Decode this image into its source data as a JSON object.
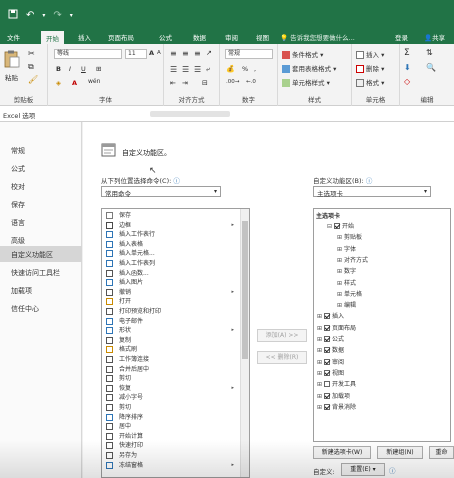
{
  "qat": {
    "save_icon": "save-icon",
    "undo_icon": "undo-icon",
    "redo_icon": "redo-icon"
  },
  "ribbon_tabs": [
    "文件",
    "开始",
    "插入",
    "页面布局",
    "公式",
    "数据",
    "审阅",
    "视图"
  ],
  "active_tab": "开始",
  "tell_me": "告诉我您想要做什么...",
  "login": "登录",
  "share": "共享",
  "ribbon": {
    "clipboard": {
      "paste": "粘贴",
      "label": "剪贴板"
    },
    "font": {
      "name": "等线",
      "size": "11",
      "bold": "B",
      "italic": "I",
      "underline": "U",
      "grow": "A",
      "shrink": "A",
      "wen": "wén",
      "label": "字体"
    },
    "alignment": {
      "label": "对齐方式"
    },
    "number": {
      "format": "常规",
      "percent": "%",
      "comma": ",",
      "label": "数字"
    },
    "styles": {
      "conditional": "条件格式",
      "table": "套用表格格式",
      "cell": "单元格样式",
      "label": "样式"
    },
    "cells": {
      "insert": "插入",
      "delete": "删除",
      "format": "格式",
      "label": "单元格"
    },
    "editing": {
      "sigma": "Σ",
      "label": "编辑"
    }
  },
  "dialog": {
    "title": "Excel 选项",
    "nav": [
      "常规",
      "公式",
      "校对",
      "保存",
      "语言",
      "高级",
      "自定义功能区",
      "快速访问工具栏",
      "加载项",
      "信任中心"
    ],
    "selected_nav": "自定义功能区",
    "heading": "自定义功能区。",
    "choose_from_label": "从下列位置选择命令(C):",
    "choose_from_value": "常用命令",
    "customize_label": "自定义功能区(B):",
    "customize_value": "主选项卡",
    "commands": [
      {
        "icon": "save-icon",
        "label": "保存",
        "sub": ""
      },
      {
        "icon": "border-icon",
        "label": "边框",
        "sub": "▸"
      },
      {
        "icon": "insert-row-icon",
        "label": "插入工作表行",
        "sub": ""
      },
      {
        "icon": "table-icon",
        "label": "插入表格",
        "sub": ""
      },
      {
        "icon": "insert-cell-icon",
        "label": "插入单元格...",
        "sub": ""
      },
      {
        "icon": "insert-col-icon",
        "label": "插入工作表列",
        "sub": ""
      },
      {
        "icon": "function-icon",
        "label": "插入函数...",
        "sub": ""
      },
      {
        "icon": "picture-icon",
        "label": "插入图片",
        "sub": ""
      },
      {
        "icon": "undo-icon",
        "label": "撤销",
        "sub": "▸"
      },
      {
        "icon": "open-icon",
        "label": "打开",
        "sub": ""
      },
      {
        "icon": "print-icon",
        "label": "打印预览和打印",
        "sub": ""
      },
      {
        "icon": "email-icon",
        "label": "电子邮件",
        "sub": ""
      },
      {
        "icon": "shape-icon",
        "label": "形状",
        "sub": "▸"
      },
      {
        "icon": "copy-icon",
        "label": "复制",
        "sub": ""
      },
      {
        "icon": "format-painter-icon",
        "label": "格式刷",
        "sub": ""
      },
      {
        "icon": "connections-icon",
        "label": "工作簿连接",
        "sub": ""
      },
      {
        "icon": "merge-icon",
        "label": "合并后居中",
        "sub": ""
      },
      {
        "icon": "cut-icon",
        "label": "剪切",
        "sub": ""
      },
      {
        "icon": "redo-icon",
        "label": "恢复",
        "sub": "▸"
      },
      {
        "icon": "font-shrink-icon",
        "label": "减小字号",
        "sub": ""
      },
      {
        "icon": "cut2-icon",
        "label": "剪切",
        "sub": ""
      },
      {
        "icon": "sort-desc-icon",
        "label": "降序排序",
        "sub": ""
      },
      {
        "icon": "center-icon",
        "label": "居中",
        "sub": ""
      },
      {
        "icon": "calculate-icon",
        "label": "开始计算",
        "sub": ""
      },
      {
        "icon": "quick-print-icon",
        "label": "快速打印",
        "sub": ""
      },
      {
        "icon": "save-as-icon",
        "label": "另存为",
        "sub": ""
      },
      {
        "icon": "freeze-icon",
        "label": "冻结窗格",
        "sub": "▸"
      }
    ],
    "add_button": "添加(A) >>",
    "remove_button": "<< 删除(R)",
    "tree_header": "主选项卡",
    "tree": [
      {
        "depth": 1,
        "toggle": "⊟",
        "checked": true,
        "label": "开始"
      },
      {
        "depth": 2,
        "toggle": "⊞",
        "checked": null,
        "label": "剪贴板"
      },
      {
        "depth": 2,
        "toggle": "⊞",
        "checked": null,
        "label": "字体"
      },
      {
        "depth": 2,
        "toggle": "⊞",
        "checked": null,
        "label": "对齐方式"
      },
      {
        "depth": 2,
        "toggle": "⊞",
        "checked": null,
        "label": "数字"
      },
      {
        "depth": 2,
        "toggle": "⊞",
        "checked": null,
        "label": "样式"
      },
      {
        "depth": 2,
        "toggle": "⊞",
        "checked": null,
        "label": "单元格"
      },
      {
        "depth": 2,
        "toggle": "⊞",
        "checked": null,
        "label": "编辑"
      },
      {
        "depth": 0,
        "toggle": "⊞",
        "checked": true,
        "label": "插入"
      },
      {
        "depth": 0,
        "toggle": "⊞",
        "checked": true,
        "label": "页面布局"
      },
      {
        "depth": 0,
        "toggle": "⊞",
        "checked": true,
        "label": "公式"
      },
      {
        "depth": 0,
        "toggle": "⊞",
        "checked": true,
        "label": "数据"
      },
      {
        "depth": 0,
        "toggle": "⊞",
        "checked": true,
        "label": "审阅"
      },
      {
        "depth": 0,
        "toggle": "⊞",
        "checked": true,
        "label": "视图"
      },
      {
        "depth": 0,
        "toggle": "⊞",
        "checked": false,
        "label": "开发工具"
      },
      {
        "depth": 0,
        "toggle": "⊞",
        "checked": true,
        "label": "加载项"
      },
      {
        "depth": 0,
        "toggle": "⊞",
        "checked": true,
        "label": "背景消除"
      }
    ],
    "new_tab_button": "新建选项卡(W)",
    "new_group_button": "新建组(N)",
    "rename_button": "重命名...",
    "customize_row_label": "自定义:",
    "reset_button": "重置(E) ▾",
    "colors": {
      "excel_green": "#217346",
      "nav_selected": "#d6d6d6"
    }
  }
}
